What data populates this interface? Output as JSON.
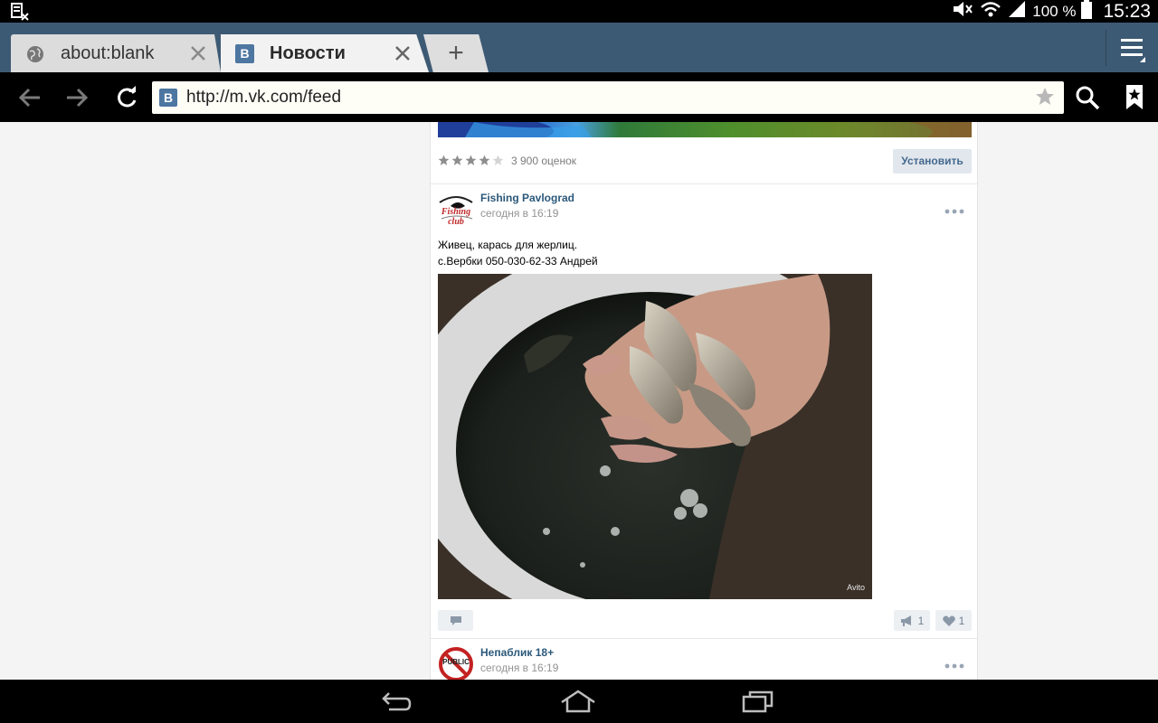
{
  "status_bar": {
    "battery_text": "100 %",
    "time": "15:23"
  },
  "tabs": [
    {
      "title": "about:blank",
      "favicon": "globe-icon",
      "active": false
    },
    {
      "title": "Новости",
      "favicon": "vk-icon",
      "active": true
    }
  ],
  "new_tab_label": "+",
  "toolbar": {
    "url": "http://m.vk.com/feed",
    "favicon_letter": "B"
  },
  "app_promo": {
    "rating_stars": 4,
    "ratings_text": "3 900 оценок",
    "install_label": "Установить"
  },
  "posts": [
    {
      "author": "Fishing Pavlograd",
      "time": "сегодня в 16:19",
      "text_lines": [
        "Живец, карась для жерлиц.",
        "с.Вербки 050-030-62-33 Андрей"
      ],
      "avatar_caption": "Fishing club",
      "photo_watermark": "Avito",
      "reposts": "1",
      "likes": "1"
    },
    {
      "author": "Непаблик 18+",
      "time": "сегодня в 16:19",
      "avatar_caption": "PUBLIC"
    }
  ],
  "colors": {
    "tab_strip": "#3d5a74",
    "link": "#2b587a",
    "accent_button": "#e1e7ed"
  }
}
